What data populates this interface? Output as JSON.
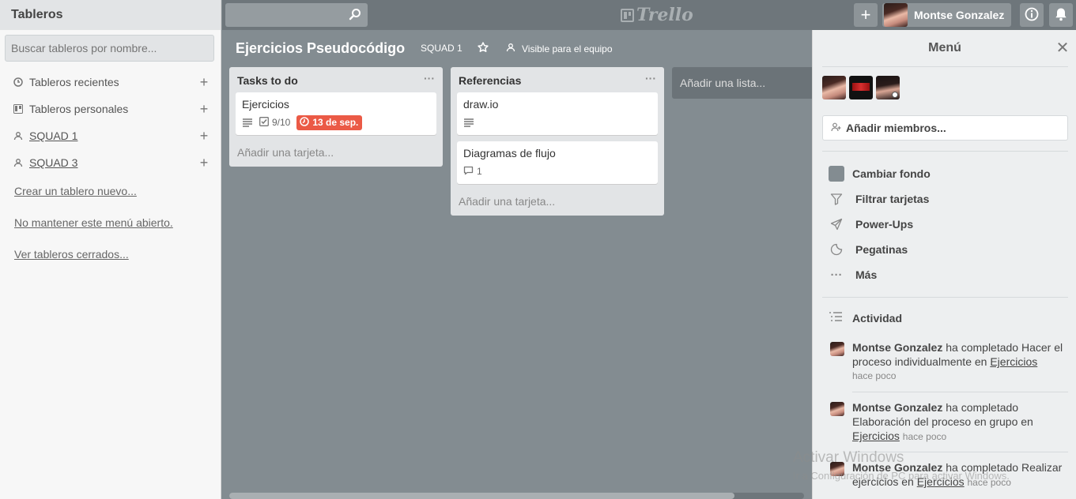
{
  "drawer": {
    "title": "Tableros",
    "search_placeholder": "Buscar tableros por nombre...",
    "items": [
      {
        "label": "Tableros recientes",
        "icon": "clock-icon"
      },
      {
        "label": "Tableros personales",
        "icon": "board-icon"
      },
      {
        "label": "SQUAD 1",
        "icon": "team-icon"
      },
      {
        "label": "SQUAD 3",
        "icon": "team-icon"
      }
    ],
    "links": {
      "create": "Crear un tablero nuevo...",
      "keep_open": "No mantener este menú abierto.",
      "closed": "Ver tableros cerrados..."
    }
  },
  "header": {
    "logo": "Trello",
    "add_label": "+",
    "user_name": "Montse Gonzalez"
  },
  "board": {
    "title": "Ejercicios Pseudocódigo",
    "team": "SQUAD 1",
    "visibility": "Visible para el equipo",
    "lists": [
      {
        "name": "Tasks to do",
        "cards": [
          {
            "title": "Ejercicios",
            "checklist": "9/10",
            "due": "13 de sep."
          }
        ],
        "add_card": "Añadir una tarjeta..."
      },
      {
        "name": "Referencias",
        "cards": [
          {
            "title": "draw.io"
          },
          {
            "title": "Diagramas de flujo",
            "comments": "1"
          }
        ],
        "add_card": "Añadir una tarjeta..."
      }
    ],
    "add_list": "Añadir una lista..."
  },
  "menu": {
    "title": "Menú",
    "add_members": "Añadir miembros...",
    "items": [
      {
        "label": "Cambiar fondo",
        "icon": "background-swatch-icon"
      },
      {
        "label": "Filtrar tarjetas",
        "icon": "filter-icon"
      },
      {
        "label": "Power-Ups",
        "icon": "rocket-icon"
      },
      {
        "label": "Pegatinas",
        "icon": "sticker-icon"
      },
      {
        "label": "Más",
        "icon": "more-icon"
      }
    ],
    "activity_title": "Actividad",
    "activities": [
      {
        "user": "Montse Gonzalez",
        "text": " ha completado Hacer el proceso individualmente en ",
        "link": "Ejercicios",
        "time": "hace poco"
      },
      {
        "user": "Montse Gonzalez",
        "text": " ha completado Elaboración del proceso en grupo en ",
        "link": "Ejercicios",
        "time": "hace poco"
      },
      {
        "user": "Montse Gonzalez",
        "text": " ha completado Realizar ejercicios en ",
        "link": "Ejercicios",
        "time": "hace poco"
      }
    ]
  },
  "watermark": {
    "line1": "Activar Windows",
    "line2": "Ir a Configuración de PC para activar Windows."
  },
  "colors": {
    "board_bg": "#838c91",
    "header_bg": "#6e767b",
    "due_red": "#eb5a46"
  }
}
